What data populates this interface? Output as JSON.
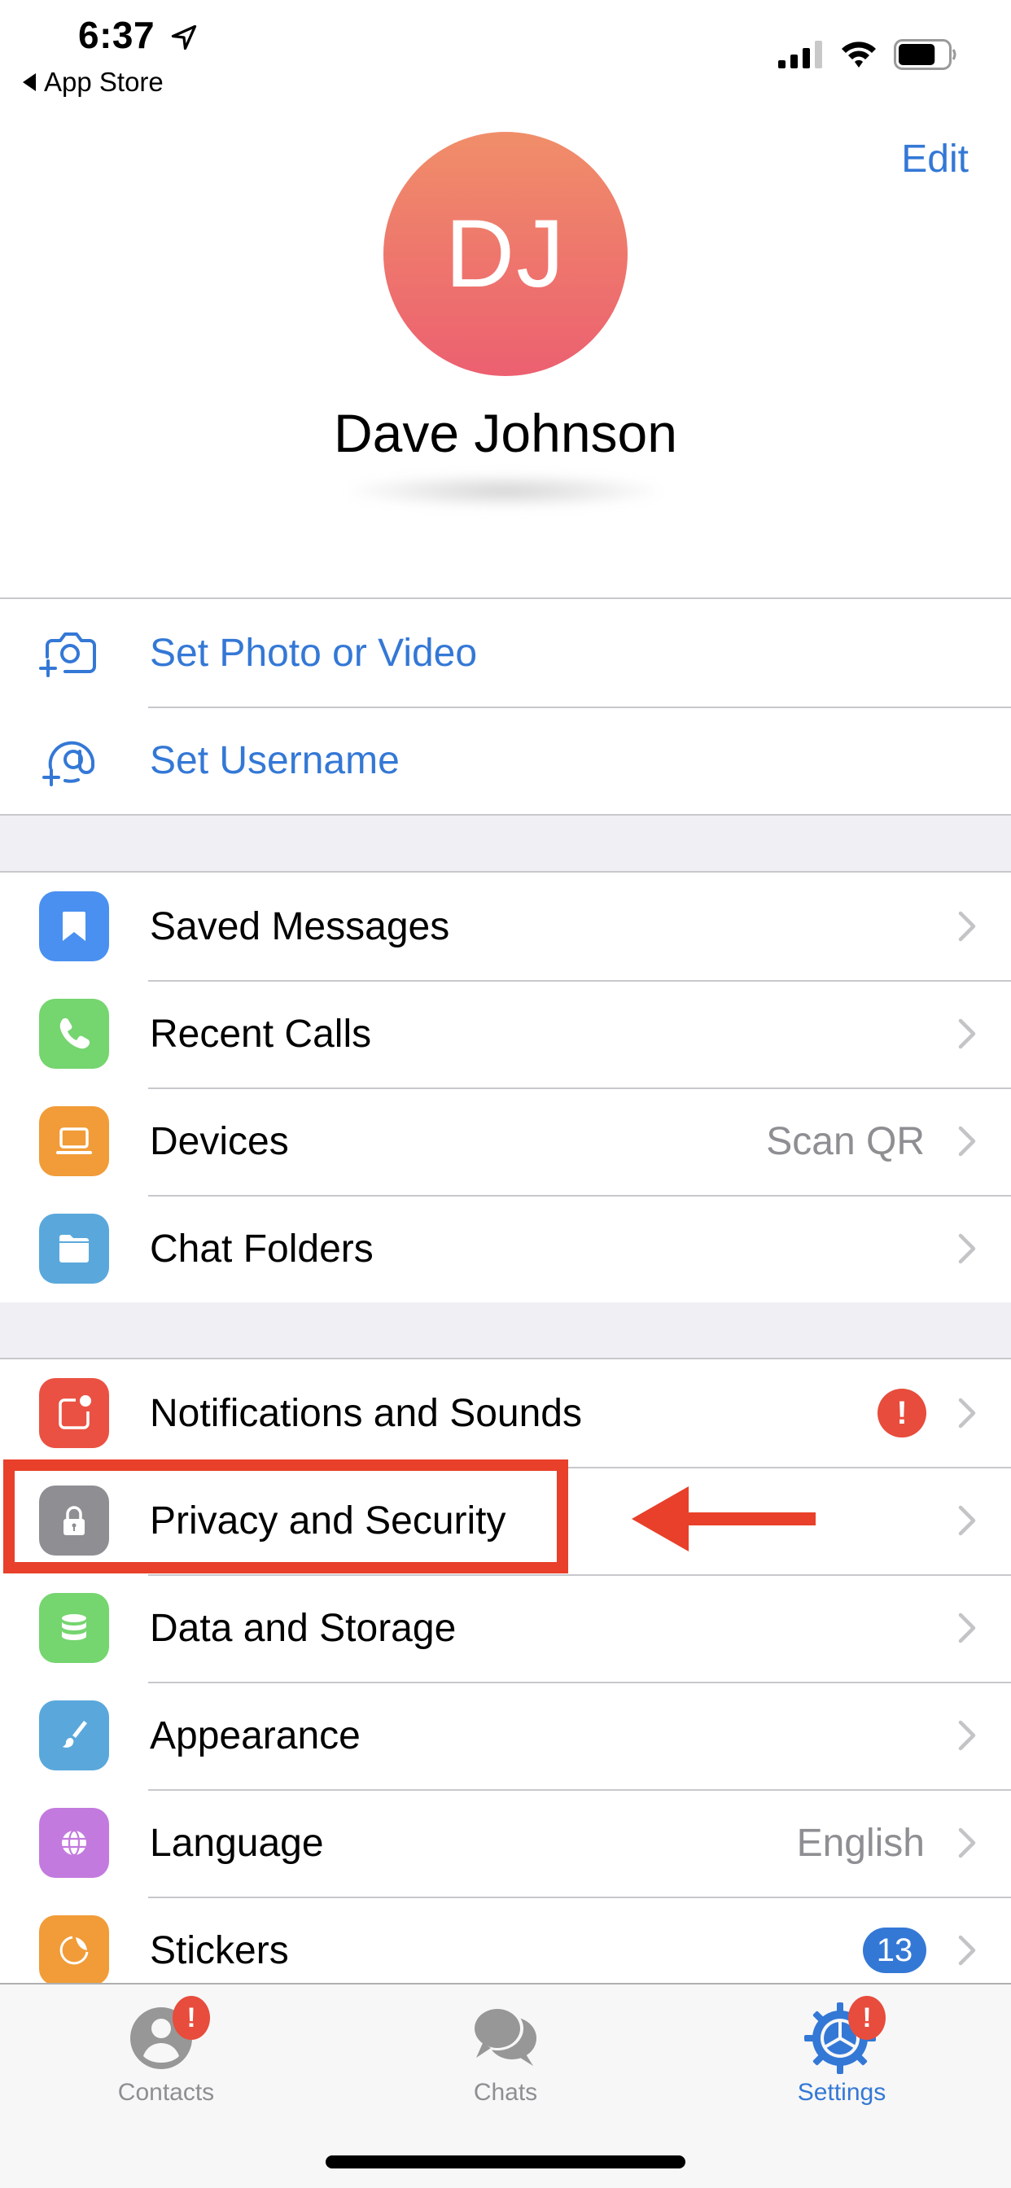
{
  "status_bar": {
    "time": "6:37",
    "back_app": "App Store",
    "battery_fraction": 0.75
  },
  "header": {
    "edit_label": "Edit"
  },
  "profile": {
    "initials": "DJ",
    "name": "Dave Johnson",
    "avatar_gradient": [
      "#f08e69",
      "#ec6070"
    ]
  },
  "actions": [
    {
      "label": "Set Photo or Video",
      "icon": "camera-add-icon"
    },
    {
      "label": "Set Username",
      "icon": "at-add-icon"
    }
  ],
  "group1": [
    {
      "label": "Saved Messages",
      "icon": "bookmark-icon",
      "color": "#4a90f0",
      "value": ""
    },
    {
      "label": "Recent Calls",
      "icon": "phone-icon",
      "color": "#75d56f",
      "value": ""
    },
    {
      "label": "Devices",
      "icon": "laptop-icon",
      "color": "#f19c38",
      "value": "Scan QR"
    },
    {
      "label": "Chat Folders",
      "icon": "folder-icon",
      "color": "#5aa8db",
      "value": ""
    }
  ],
  "group2": [
    {
      "label": "Notifications and Sounds",
      "icon": "notification-icon",
      "color": "#ea5143",
      "alert_badge": "!"
    },
    {
      "label": "Privacy and Security",
      "icon": "lock-icon",
      "color": "#8e8e93"
    },
    {
      "label": "Data and Storage",
      "icon": "database-icon",
      "color": "#75d56f"
    },
    {
      "label": "Appearance",
      "icon": "brush-icon",
      "color": "#5aa8db"
    },
    {
      "label": "Language",
      "icon": "globe-icon",
      "color": "#c37ade",
      "value": "English"
    },
    {
      "label": "Stickers",
      "icon": "sticker-icon",
      "color": "#f19c38",
      "count_badge": "13"
    }
  ],
  "annotation": {
    "highlighted_item": "Privacy and Security",
    "color": "#e8402a"
  },
  "tab_bar": {
    "tabs": [
      {
        "label": "Contacts",
        "badge": "!",
        "active": false
      },
      {
        "label": "Chats",
        "badge": "",
        "active": false
      },
      {
        "label": "Settings",
        "badge": "!",
        "active": true
      }
    ]
  },
  "colors": {
    "accent": "#3478d6",
    "alert": "#e74c3c",
    "secondary_text": "#8e8e93",
    "group_background": "#efeff4"
  }
}
